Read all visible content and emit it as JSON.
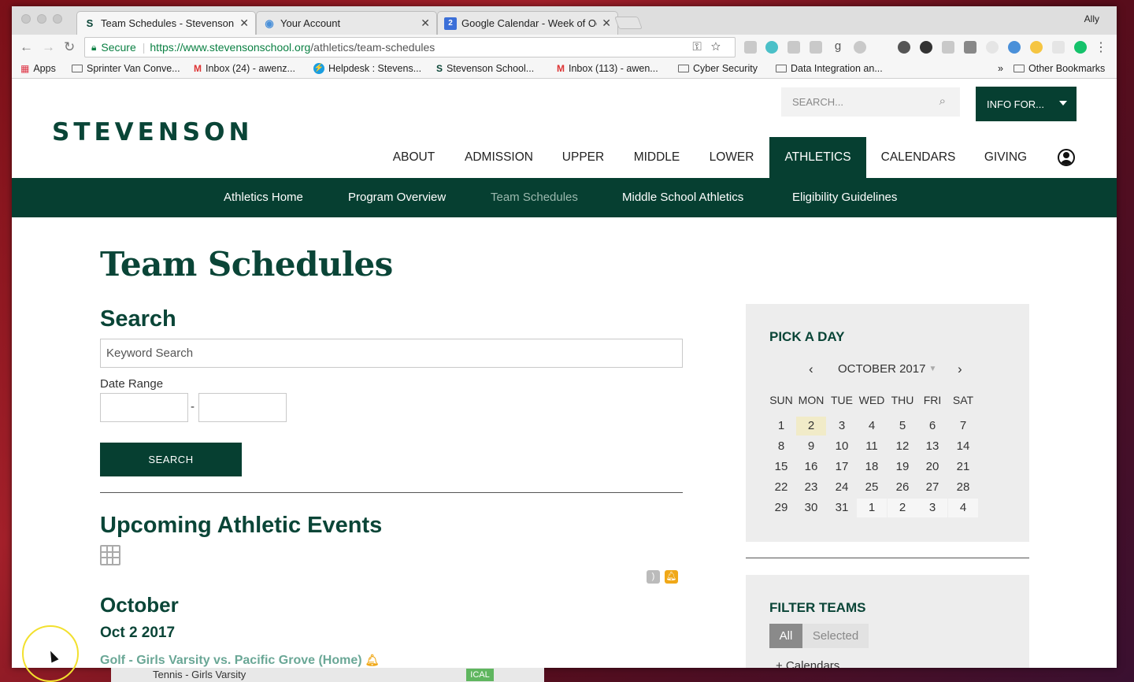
{
  "browser": {
    "tabs": [
      {
        "title": "Team Schedules - Stevenson S",
        "favicon": "S"
      },
      {
        "title": "Your Account",
        "favicon": "◉"
      },
      {
        "title": "Google Calendar - Week of Oc",
        "favicon": "2"
      }
    ],
    "user": "Ally",
    "secure_label": "Secure",
    "url_host": "https://www.stevensonschool.org",
    "url_path": "/athletics/team-schedules",
    "bookmarks": [
      {
        "label": "Apps",
        "icon": "apps-grid-icon"
      },
      {
        "label": "Sprinter Van Conve...",
        "icon": "folder-icon"
      },
      {
        "label": "Inbox (24) - awenz...",
        "icon": "gmail-icon"
      },
      {
        "label": "Helpdesk : Stevens...",
        "icon": "helpdesk-icon"
      },
      {
        "label": "Stevenson School...",
        "icon": "stevenson-icon"
      },
      {
        "label": "Inbox (113) - awen...",
        "icon": "gmail-icon"
      },
      {
        "label": "Cyber Security",
        "icon": "folder-icon"
      },
      {
        "label": "Data Integration an...",
        "icon": "folder-icon"
      }
    ],
    "overflow": "»",
    "other_bookmarks": "Other Bookmarks"
  },
  "site": {
    "logo": "STEVENSON",
    "search_placeholder": "SEARCH...",
    "info_button": "INFO FOR...",
    "nav": [
      {
        "label": "ABOUT"
      },
      {
        "label": "ADMISSION"
      },
      {
        "label": "UPPER"
      },
      {
        "label": "MIDDLE"
      },
      {
        "label": "LOWER"
      },
      {
        "label": "ATHLETICS",
        "active": true
      },
      {
        "label": "CALENDARS"
      },
      {
        "label": "GIVING"
      }
    ],
    "subnav": [
      {
        "label": "Athletics Home"
      },
      {
        "label": "Program Overview"
      },
      {
        "label": "Team Schedules",
        "current": true
      },
      {
        "label": "Middle School Athletics"
      },
      {
        "label": "Eligibility Guidelines"
      }
    ]
  },
  "main": {
    "page_title": "Team Schedules",
    "search_heading": "Search",
    "keyword_placeholder": "Keyword Search",
    "date_range_label": "Date Range",
    "date_separator": "-",
    "search_button": "SEARCH",
    "upcoming_heading": "Upcoming Athletic Events",
    "month_heading": "October",
    "date_heading": "Oct 2 2017",
    "event_title": "Golf - Girls Varsity vs. Pacific Grove (Home)"
  },
  "calendar": {
    "title": "PICK A DAY",
    "prev": "‹",
    "next": "›",
    "month_label": "OCTOBER 2017",
    "weekdays": [
      "SUN",
      "MON",
      "TUE",
      "WED",
      "THU",
      "FRI",
      "SAT"
    ],
    "weeks": [
      [
        "1",
        "2",
        "3",
        "4",
        "5",
        "6",
        "7"
      ],
      [
        "8",
        "9",
        "10",
        "11",
        "12",
        "13",
        "14"
      ],
      [
        "15",
        "16",
        "17",
        "18",
        "19",
        "20",
        "21"
      ],
      [
        "22",
        "23",
        "24",
        "25",
        "26",
        "27",
        "28"
      ],
      [
        "29",
        "30",
        "31",
        "1",
        "2",
        "3",
        "4"
      ]
    ],
    "selected_day": "2"
  },
  "filter": {
    "title": "FILTER TEAMS",
    "all": "All",
    "selected": "Selected",
    "calendars": "+ Calendars"
  },
  "background": {
    "behind_row": "Tennis - Girls Varsity",
    "behind_badge": "ICAL"
  },
  "colors": {
    "brand_green": "#063f31",
    "link_green": "#6aa796",
    "alert_orange": "#f0a818",
    "today_highlight": "#f1ebc8"
  }
}
